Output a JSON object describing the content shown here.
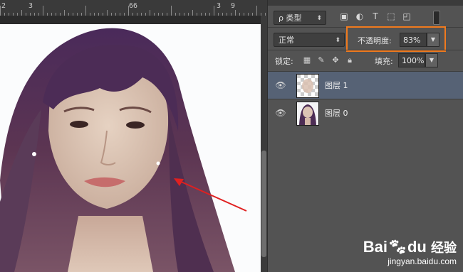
{
  "ruler": {
    "labels": [
      "2",
      "3",
      "66",
      "3",
      "9"
    ]
  },
  "layers_panel": {
    "filter": {
      "label": "ρ 类型",
      "icons": [
        "image-filter-icon",
        "adjustment-filter-icon",
        "type-filter-icon",
        "shape-filter-icon",
        "smart-object-filter-icon"
      ]
    },
    "blend_mode": "正常",
    "opacity": {
      "label": "不透明度:",
      "value": "83%"
    },
    "lock": {
      "label": "锁定:",
      "icons": [
        "lock-transparent-icon",
        "lock-paint-icon",
        "lock-move-icon",
        "lock-all-icon"
      ]
    },
    "fill": {
      "label": "填充:",
      "value": "100%"
    },
    "layers": [
      {
        "name": "图层 1",
        "selected": true,
        "visible": true
      },
      {
        "name": "图层 0",
        "selected": false,
        "visible": true
      }
    ]
  },
  "watermark": {
    "brand": "Bai",
    "brand2": "du",
    "suffix": "经验",
    "url": "jingyan.baidu.com"
  },
  "colors": {
    "highlight": "#f07a1e",
    "selected_layer": "#566275",
    "arrow": "#e02020"
  }
}
